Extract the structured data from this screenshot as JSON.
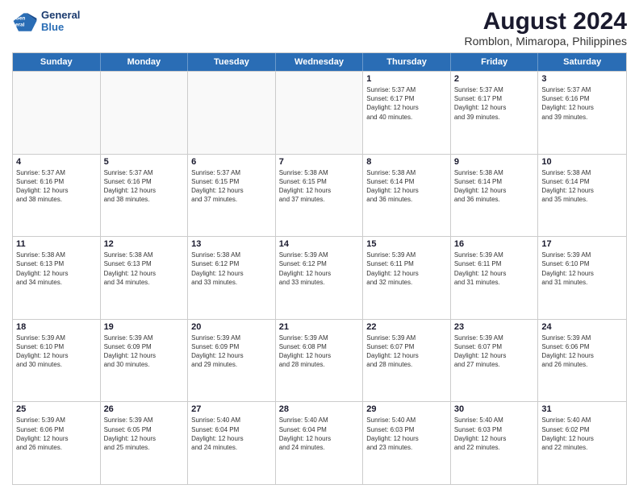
{
  "logo": {
    "line1": "General",
    "line2": "Blue"
  },
  "title": "August 2024",
  "subtitle": "Romblon, Mimaropa, Philippines",
  "header_days": [
    "Sunday",
    "Monday",
    "Tuesday",
    "Wednesday",
    "Thursday",
    "Friday",
    "Saturday"
  ],
  "weeks": [
    [
      {
        "num": "",
        "info": "",
        "shaded": true
      },
      {
        "num": "",
        "info": "",
        "shaded": true
      },
      {
        "num": "",
        "info": "",
        "shaded": true
      },
      {
        "num": "",
        "info": "",
        "shaded": true
      },
      {
        "num": "1",
        "info": "Sunrise: 5:37 AM\nSunset: 6:17 PM\nDaylight: 12 hours\nand 40 minutes.",
        "shaded": false
      },
      {
        "num": "2",
        "info": "Sunrise: 5:37 AM\nSunset: 6:17 PM\nDaylight: 12 hours\nand 39 minutes.",
        "shaded": false
      },
      {
        "num": "3",
        "info": "Sunrise: 5:37 AM\nSunset: 6:16 PM\nDaylight: 12 hours\nand 39 minutes.",
        "shaded": false
      }
    ],
    [
      {
        "num": "4",
        "info": "Sunrise: 5:37 AM\nSunset: 6:16 PM\nDaylight: 12 hours\nand 38 minutes.",
        "shaded": false
      },
      {
        "num": "5",
        "info": "Sunrise: 5:37 AM\nSunset: 6:16 PM\nDaylight: 12 hours\nand 38 minutes.",
        "shaded": false
      },
      {
        "num": "6",
        "info": "Sunrise: 5:37 AM\nSunset: 6:15 PM\nDaylight: 12 hours\nand 37 minutes.",
        "shaded": false
      },
      {
        "num": "7",
        "info": "Sunrise: 5:38 AM\nSunset: 6:15 PM\nDaylight: 12 hours\nand 37 minutes.",
        "shaded": false
      },
      {
        "num": "8",
        "info": "Sunrise: 5:38 AM\nSunset: 6:14 PM\nDaylight: 12 hours\nand 36 minutes.",
        "shaded": false
      },
      {
        "num": "9",
        "info": "Sunrise: 5:38 AM\nSunset: 6:14 PM\nDaylight: 12 hours\nand 36 minutes.",
        "shaded": false
      },
      {
        "num": "10",
        "info": "Sunrise: 5:38 AM\nSunset: 6:14 PM\nDaylight: 12 hours\nand 35 minutes.",
        "shaded": false
      }
    ],
    [
      {
        "num": "11",
        "info": "Sunrise: 5:38 AM\nSunset: 6:13 PM\nDaylight: 12 hours\nand 34 minutes.",
        "shaded": false
      },
      {
        "num": "12",
        "info": "Sunrise: 5:38 AM\nSunset: 6:13 PM\nDaylight: 12 hours\nand 34 minutes.",
        "shaded": false
      },
      {
        "num": "13",
        "info": "Sunrise: 5:38 AM\nSunset: 6:12 PM\nDaylight: 12 hours\nand 33 minutes.",
        "shaded": false
      },
      {
        "num": "14",
        "info": "Sunrise: 5:39 AM\nSunset: 6:12 PM\nDaylight: 12 hours\nand 33 minutes.",
        "shaded": false
      },
      {
        "num": "15",
        "info": "Sunrise: 5:39 AM\nSunset: 6:11 PM\nDaylight: 12 hours\nand 32 minutes.",
        "shaded": false
      },
      {
        "num": "16",
        "info": "Sunrise: 5:39 AM\nSunset: 6:11 PM\nDaylight: 12 hours\nand 31 minutes.",
        "shaded": false
      },
      {
        "num": "17",
        "info": "Sunrise: 5:39 AM\nSunset: 6:10 PM\nDaylight: 12 hours\nand 31 minutes.",
        "shaded": false
      }
    ],
    [
      {
        "num": "18",
        "info": "Sunrise: 5:39 AM\nSunset: 6:10 PM\nDaylight: 12 hours\nand 30 minutes.",
        "shaded": false
      },
      {
        "num": "19",
        "info": "Sunrise: 5:39 AM\nSunset: 6:09 PM\nDaylight: 12 hours\nand 30 minutes.",
        "shaded": false
      },
      {
        "num": "20",
        "info": "Sunrise: 5:39 AM\nSunset: 6:09 PM\nDaylight: 12 hours\nand 29 minutes.",
        "shaded": false
      },
      {
        "num": "21",
        "info": "Sunrise: 5:39 AM\nSunset: 6:08 PM\nDaylight: 12 hours\nand 28 minutes.",
        "shaded": false
      },
      {
        "num": "22",
        "info": "Sunrise: 5:39 AM\nSunset: 6:07 PM\nDaylight: 12 hours\nand 28 minutes.",
        "shaded": false
      },
      {
        "num": "23",
        "info": "Sunrise: 5:39 AM\nSunset: 6:07 PM\nDaylight: 12 hours\nand 27 minutes.",
        "shaded": false
      },
      {
        "num": "24",
        "info": "Sunrise: 5:39 AM\nSunset: 6:06 PM\nDaylight: 12 hours\nand 26 minutes.",
        "shaded": false
      }
    ],
    [
      {
        "num": "25",
        "info": "Sunrise: 5:39 AM\nSunset: 6:06 PM\nDaylight: 12 hours\nand 26 minutes.",
        "shaded": false
      },
      {
        "num": "26",
        "info": "Sunrise: 5:39 AM\nSunset: 6:05 PM\nDaylight: 12 hours\nand 25 minutes.",
        "shaded": false
      },
      {
        "num": "27",
        "info": "Sunrise: 5:40 AM\nSunset: 6:04 PM\nDaylight: 12 hours\nand 24 minutes.",
        "shaded": false
      },
      {
        "num": "28",
        "info": "Sunrise: 5:40 AM\nSunset: 6:04 PM\nDaylight: 12 hours\nand 24 minutes.",
        "shaded": false
      },
      {
        "num": "29",
        "info": "Sunrise: 5:40 AM\nSunset: 6:03 PM\nDaylight: 12 hours\nand 23 minutes.",
        "shaded": false
      },
      {
        "num": "30",
        "info": "Sunrise: 5:40 AM\nSunset: 6:03 PM\nDaylight: 12 hours\nand 22 minutes.",
        "shaded": false
      },
      {
        "num": "31",
        "info": "Sunrise: 5:40 AM\nSunset: 6:02 PM\nDaylight: 12 hours\nand 22 minutes.",
        "shaded": false
      }
    ]
  ]
}
